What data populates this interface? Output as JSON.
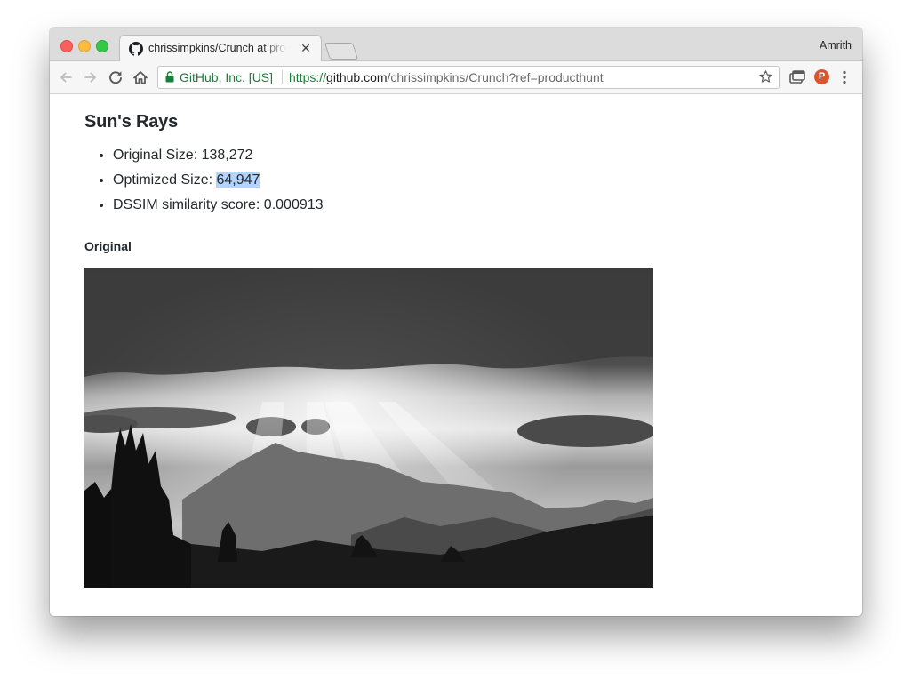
{
  "browser": {
    "tab": {
      "title": "chrissimpkins/Crunch at product hunt",
      "close_glyph": "✕",
      "favicon": "github-icon"
    },
    "profile_name": "Amrith",
    "address_bar": {
      "site_identity": "GitHub, Inc. [US]",
      "url_scheme": "https://",
      "url_host": "github.com",
      "url_path": "/chrissimpkins/Crunch?ref=producthunt",
      "secure_color": "#188038"
    },
    "extension_badge": "P"
  },
  "page": {
    "heading": "Sun's Rays",
    "stats": [
      {
        "label": "Original Size: ",
        "value": "138,272"
      },
      {
        "label": "Optimized Size: ",
        "value": "64,947",
        "selected": true
      },
      {
        "label": "DSSIM similarity score: ",
        "value": "0.000913"
      }
    ],
    "image_caption": "Original",
    "image": {
      "description": "black-and-white-photo",
      "tone": "grayscale"
    }
  },
  "colors": {
    "traffic_red": "#fc605c",
    "traffic_yellow": "#fdbc40",
    "traffic_green": "#34c84a",
    "selection_highlight": "#b3d4fd",
    "text": "#24292e"
  }
}
